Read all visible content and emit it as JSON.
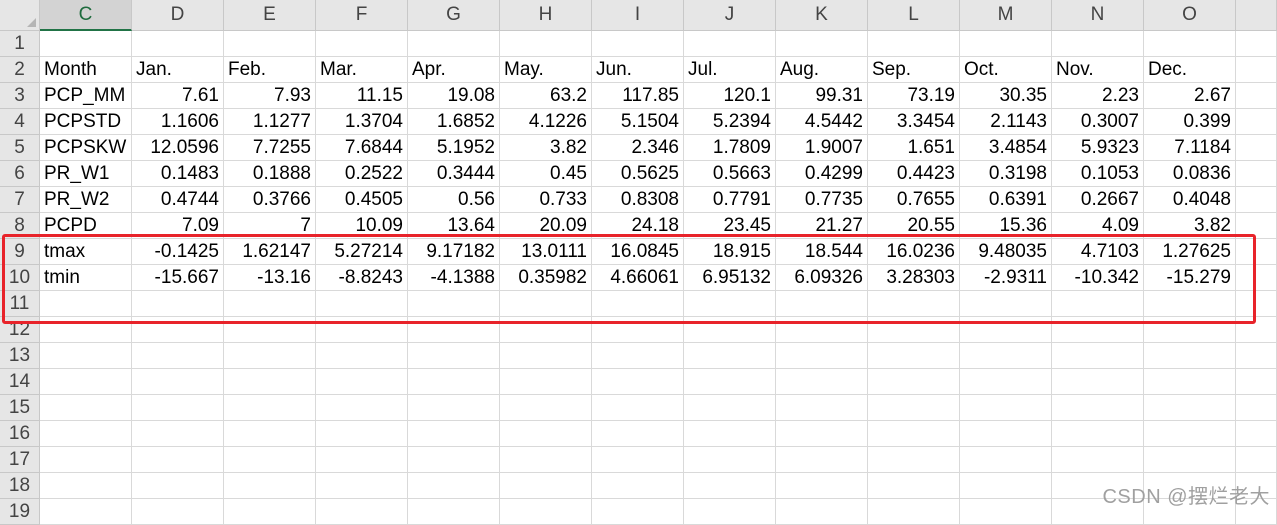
{
  "columns": [
    "C",
    "D",
    "E",
    "F",
    "G",
    "H",
    "I",
    "J",
    "K",
    "L",
    "M",
    "N",
    "O"
  ],
  "selected_column": "C",
  "row_numbers": [
    "1",
    "2",
    "3",
    "4",
    "5",
    "6",
    "7",
    "8",
    "9",
    "10",
    "11",
    "12",
    "13",
    "14",
    "15",
    "16",
    "17",
    "18",
    "19"
  ],
  "rows": [
    [
      "",
      "",
      "",
      "",
      "",
      "",
      "",
      "",
      "",
      "",
      "",
      "",
      ""
    ],
    [
      "Month",
      "Jan.",
      "Feb.",
      "Mar.",
      "Apr.",
      "May.",
      "Jun.",
      "Jul.",
      "Aug.",
      "Sep.",
      "Oct.",
      "Nov.",
      "Dec."
    ],
    [
      "PCP_MM",
      "7.61",
      "7.93",
      "11.15",
      "19.08",
      "63.2",
      "117.85",
      "120.1",
      "99.31",
      "73.19",
      "30.35",
      "2.23",
      "2.67"
    ],
    [
      "PCPSTD",
      "1.1606",
      "1.1277",
      "1.3704",
      "1.6852",
      "4.1226",
      "5.1504",
      "5.2394",
      "4.5442",
      "3.3454",
      "2.1143",
      "0.3007",
      "0.399"
    ],
    [
      "PCPSKW",
      "12.0596",
      "7.7255",
      "7.6844",
      "5.1952",
      "3.82",
      "2.346",
      "1.7809",
      "1.9007",
      "1.651",
      "3.4854",
      "5.9323",
      "7.1184"
    ],
    [
      "PR_W1",
      "0.1483",
      "0.1888",
      "0.2522",
      "0.3444",
      "0.45",
      "0.5625",
      "0.5663",
      "0.4299",
      "0.4423",
      "0.3198",
      "0.1053",
      "0.0836"
    ],
    [
      "PR_W2",
      "0.4744",
      "0.3766",
      "0.4505",
      "0.56",
      "0.733",
      "0.8308",
      "0.7791",
      "0.7735",
      "0.7655",
      "0.6391",
      "0.2667",
      "0.4048"
    ],
    [
      "PCPD",
      "7.09",
      "7",
      "10.09",
      "13.64",
      "20.09",
      "24.18",
      "23.45",
      "21.27",
      "20.55",
      "15.36",
      "4.09",
      "3.82"
    ],
    [
      "tmax",
      "-0.1425",
      "1.62147",
      "5.27214",
      "9.17182",
      "13.0111",
      "16.0845",
      "18.915",
      "18.544",
      "16.0236",
      "9.48035",
      "4.7103",
      "1.27625"
    ],
    [
      "tmin",
      "-15.667",
      "-13.16",
      "-8.8243",
      "-4.1388",
      "0.35982",
      "4.66061",
      "6.95132",
      "6.09326",
      "3.28303",
      "-2.9311",
      "-10.342",
      "-15.279"
    ],
    [
      "",
      "",
      "",
      "",
      "",
      "",
      "",
      "",
      "",
      "",
      "",
      "",
      ""
    ],
    [
      "",
      "",
      "",
      "",
      "",
      "",
      "",
      "",
      "",
      "",
      "",
      "",
      ""
    ],
    [
      "",
      "",
      "",
      "",
      "",
      "",
      "",
      "",
      "",
      "",
      "",
      "",
      ""
    ],
    [
      "",
      "",
      "",
      "",
      "",
      "",
      "",
      "",
      "",
      "",
      "",
      "",
      ""
    ],
    [
      "",
      "",
      "",
      "",
      "",
      "",
      "",
      "",
      "",
      "",
      "",
      "",
      ""
    ],
    [
      "",
      "",
      "",
      "",
      "",
      "",
      "",
      "",
      "",
      "",
      "",
      "",
      ""
    ],
    [
      "",
      "",
      "",
      "",
      "",
      "",
      "",
      "",
      "",
      "",
      "",
      "",
      ""
    ],
    [
      "",
      "",
      "",
      "",
      "",
      "",
      "",
      "",
      "",
      "",
      "",
      "",
      ""
    ],
    [
      "",
      "",
      "",
      "",
      "",
      "",
      "",
      "",
      "",
      "",
      "",
      "",
      ""
    ]
  ],
  "highlight_color": "#e8232a",
  "header_accent_color": "#217346",
  "watermark": "CSDN @摆烂老大"
}
